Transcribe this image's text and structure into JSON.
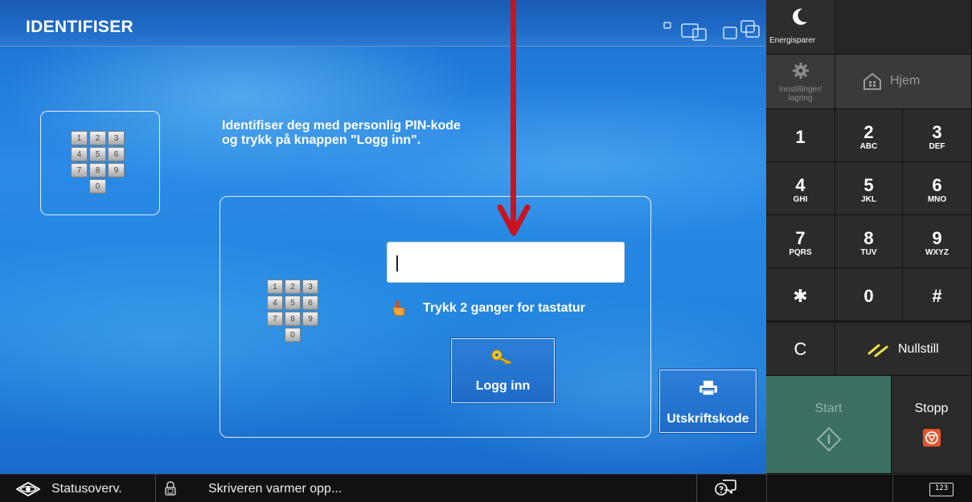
{
  "window": {
    "title": "IDENTIFISER"
  },
  "login": {
    "instruction": "Identifiser deg med personlig PIN-kode\n og trykk på knappen \"Logg inn\".",
    "pin_value": "",
    "hint": "Trykk 2 ganger for tastatur",
    "login_label": "Logg inn",
    "printcode_label": "Utskriftskode",
    "keypad_keys": [
      "1",
      "2",
      "3",
      "4",
      "5",
      "6",
      "7",
      "8",
      "9",
      "0"
    ]
  },
  "panel": {
    "energy_label": "Energisparer",
    "settings_label": "Innstillinger/\nlagring",
    "home_label": "Hjem",
    "keys": [
      {
        "d": "1",
        "sub": ""
      },
      {
        "d": "2",
        "sub": "ABC"
      },
      {
        "d": "3",
        "sub": "DEF"
      },
      {
        "d": "4",
        "sub": "GHI"
      },
      {
        "d": "5",
        "sub": "JKL"
      },
      {
        "d": "6",
        "sub": "MNO"
      },
      {
        "d": "7",
        "sub": "PQRS"
      },
      {
        "d": "8",
        "sub": "TUV"
      },
      {
        "d": "9",
        "sub": "WXYZ"
      },
      {
        "d": "✱",
        "sub": ""
      },
      {
        "d": "0",
        "sub": ""
      },
      {
        "d": "#",
        "sub": ""
      }
    ],
    "clear_label": "C",
    "reset_label": "Nullstill",
    "start_label": "Start",
    "stop_label": "Stopp"
  },
  "statusbar": {
    "status_label": "Statusoverv.",
    "message": "Skriveren varmer opp...",
    "keyboard_label": "123"
  },
  "colors": {
    "accent_blue": "#1f6cc8",
    "arrow_red": "#c8141e",
    "start_green": "#3e6f63",
    "stop_orange": "#e8542a"
  }
}
